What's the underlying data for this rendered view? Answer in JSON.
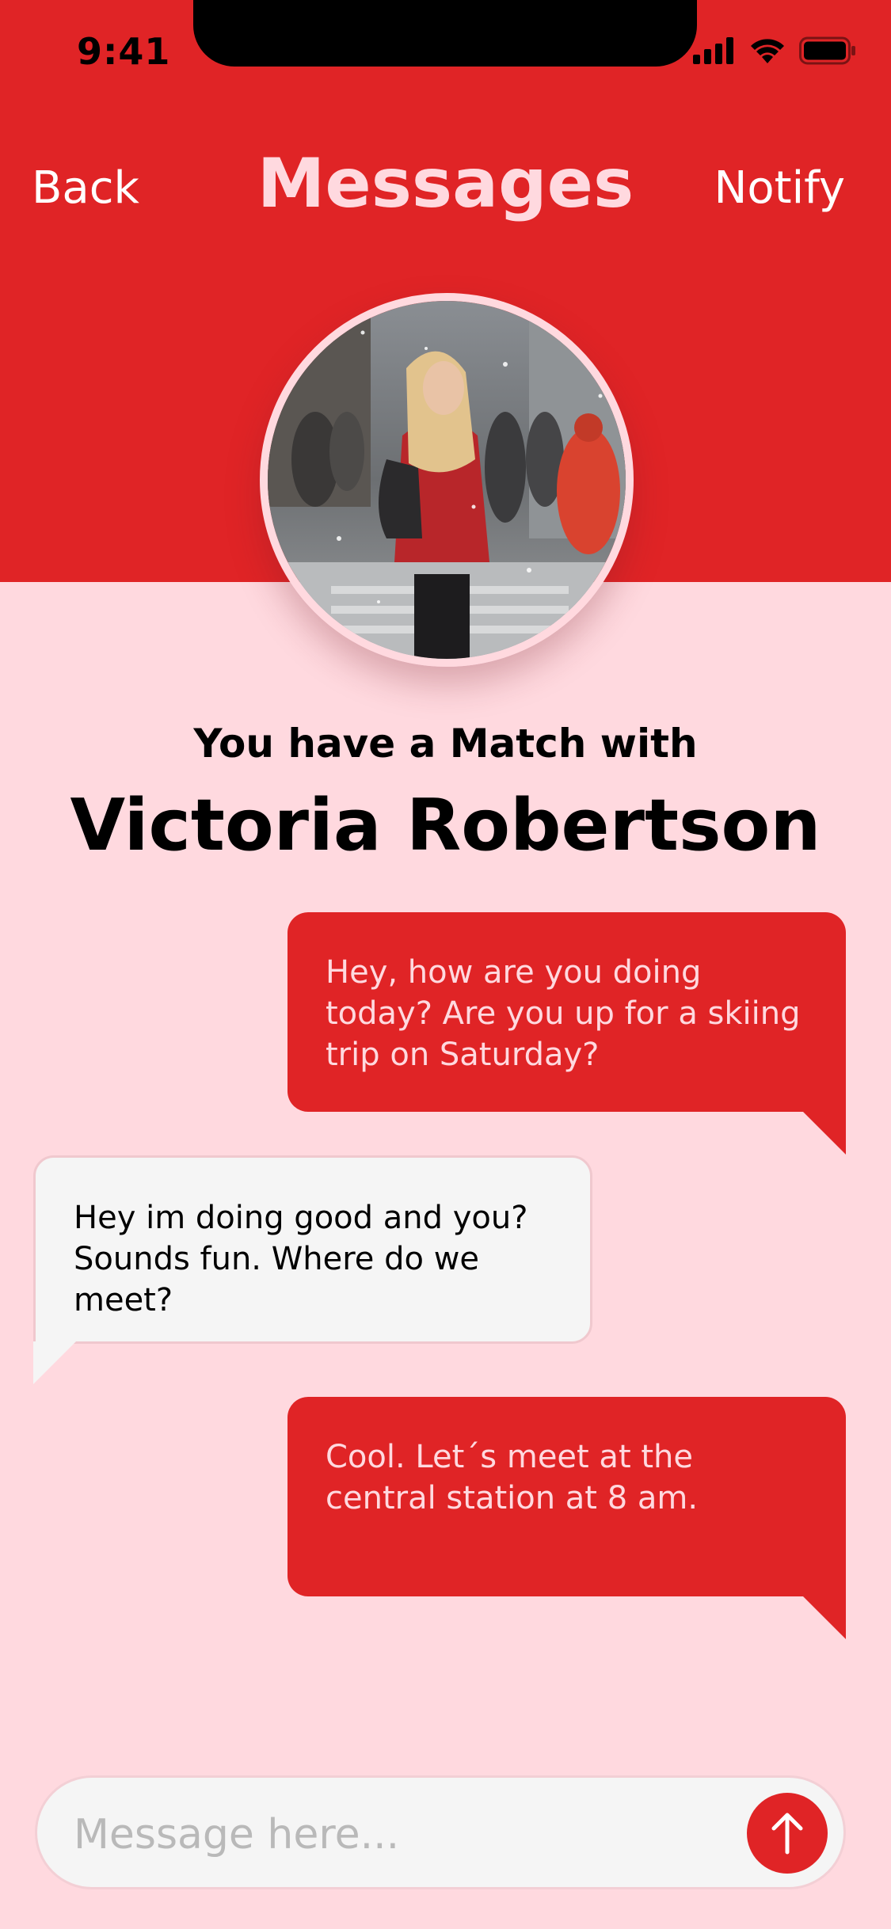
{
  "status_bar": {
    "time": "9:41",
    "icons": [
      "signal-icon",
      "wifi-icon",
      "battery-icon"
    ]
  },
  "nav": {
    "back_label": "Back",
    "title": "Messages",
    "notify_label": "Notify"
  },
  "profile": {
    "photo": "profile-photo"
  },
  "match": {
    "line": "You have a Match with",
    "name": "Victoria Robertson"
  },
  "messages": [
    {
      "sender": "me",
      "text": "Hey, how are you doing today? Are you up for a skiing trip on Saturday?"
    },
    {
      "sender": "them",
      "text": "Hey im doing good and you? Sounds fun. Where do we meet?"
    },
    {
      "sender": "me",
      "text": "Cool. Let´s meet at the central station at 8 am."
    }
  ],
  "composer": {
    "placeholder": "Message here...",
    "send_icon": "arrow-up-icon"
  },
  "colors": {
    "accent_red": "#E02426",
    "background_pink": "#FFD9DF",
    "incoming_bubble": "#F5F5F5"
  }
}
